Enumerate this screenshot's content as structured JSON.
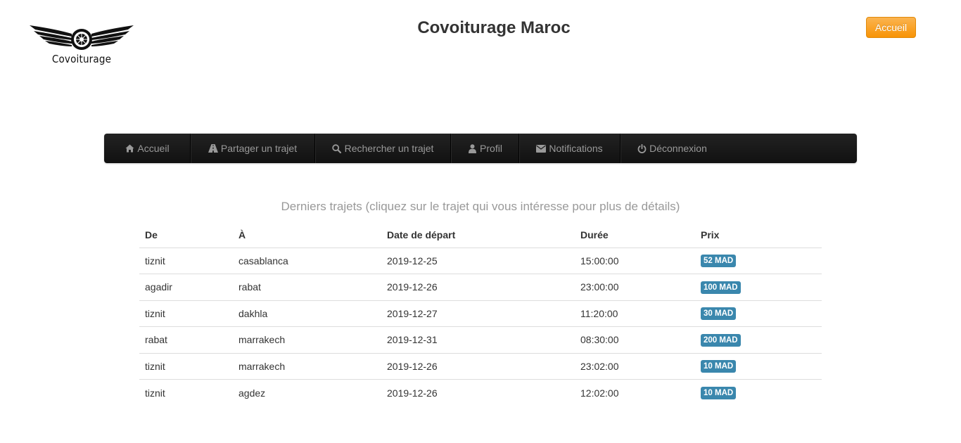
{
  "header": {
    "logo_text": "Covoiturage",
    "title": "Covoiturage Maroc",
    "home_button": "Accueil"
  },
  "nav": {
    "items": [
      {
        "label": "Accueil",
        "icon": "home-icon"
      },
      {
        "label": "Partager un trajet",
        "icon": "road-icon"
      },
      {
        "label": "Rechercher un trajet",
        "icon": "search-icon"
      },
      {
        "label": "Profil",
        "icon": "user-icon"
      },
      {
        "label": "Notifications",
        "icon": "envelope-icon"
      },
      {
        "label": "Déconnexion",
        "icon": "power-icon"
      }
    ]
  },
  "main": {
    "subtitle": "Derniers trajets (cliquez sur le trajet qui vous intéresse pour plus de détails)",
    "table": {
      "headers": [
        "De",
        "À",
        "Date de départ",
        "Durée",
        "Prix"
      ],
      "rows": [
        {
          "from": "tiznit",
          "to": "casablanca",
          "date": "2019-12-25",
          "duration": "15:00:00",
          "price": "52 MAD"
        },
        {
          "from": "agadir",
          "to": "rabat",
          "date": "2019-12-26",
          "duration": "23:00:00",
          "price": "100 MAD"
        },
        {
          "from": "tiznit",
          "to": "dakhla",
          "date": "2019-12-27",
          "duration": "11:20:00",
          "price": "30 MAD"
        },
        {
          "from": "rabat",
          "to": "marrakech",
          "date": "2019-12-31",
          "duration": "08:30:00",
          "price": "200 MAD"
        },
        {
          "from": "tiznit",
          "to": "marrakech",
          "date": "2019-12-26",
          "duration": "23:02:00",
          "price": "10 MAD"
        },
        {
          "from": "tiznit",
          "to": "agdez",
          "date": "2019-12-26",
          "duration": "12:02:00",
          "price": "10 MAD"
        }
      ]
    }
  },
  "colors": {
    "accent_orange": "#f89406",
    "navbar": "#1b1b1b",
    "badge_blue": "#3a87ad",
    "muted_text": "#999999"
  }
}
